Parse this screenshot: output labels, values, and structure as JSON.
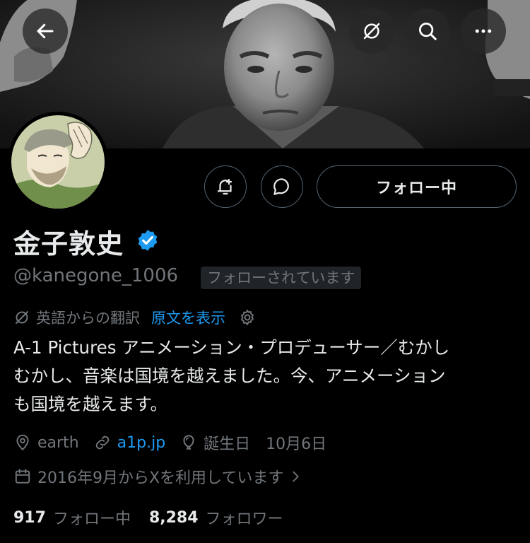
{
  "header": {
    "back_icon": "arrow-left-icon",
    "translate_icon": "translate-off-icon",
    "search_icon": "search-icon",
    "more_icon": "more-horizontal-icon"
  },
  "actions": {
    "notify_icon": "bell-plus-icon",
    "message_icon": "message-bubble-icon",
    "following_label": "フォロー中"
  },
  "profile": {
    "display_name": "金子敦史",
    "verified_icon": "verified-badge-icon",
    "verified_color": "#1d9bf0",
    "handle": "@kanegone_1006",
    "follows_you_label": "フォローされています"
  },
  "translation": {
    "label": "英語からの翻訳",
    "show_original": "原文を表示",
    "icon": "translate-off-icon",
    "settings_icon": "gear-icon"
  },
  "bio": "A-1 Pictures アニメーション・プロデューサー／むかし\nむかし、音楽は国境を越えました。今、アニメーション\nも国境を越えます。",
  "meta": {
    "location_icon": "location-pin-icon",
    "location": "earth",
    "link_icon": "link-icon",
    "link": "a1p.jp",
    "birthday_icon": "balloon-icon",
    "birthday_label": "誕生日",
    "birthday_date": "10月6日",
    "joined_icon": "calendar-icon",
    "joined": "2016年9月からXを利用しています",
    "joined_chevron_icon": "chevron-right-icon"
  },
  "stats": {
    "following_count": "917",
    "following_label": "フォロー中",
    "followers_count": "8,284",
    "followers_label": "フォロワー"
  },
  "colors": {
    "background": "#000000",
    "primary_text": "#e7e9ea",
    "secondary_text": "#71767b",
    "accent": "#1d9bf0",
    "border": "#536471"
  }
}
